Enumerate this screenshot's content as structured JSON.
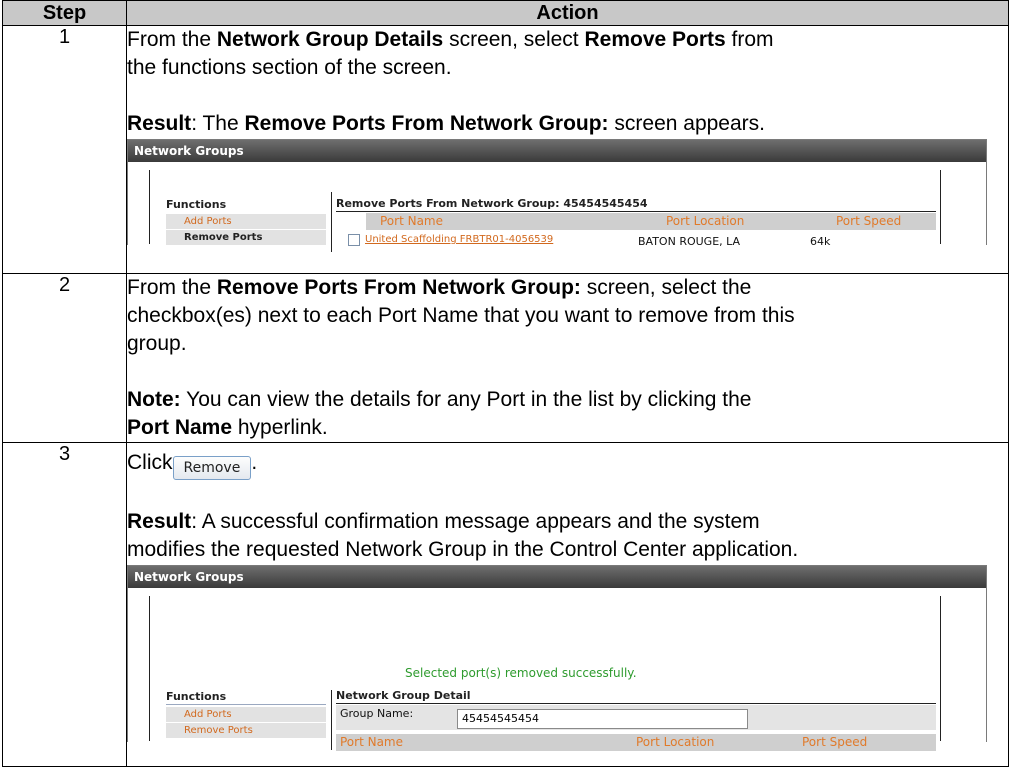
{
  "table": {
    "header_step": "Step",
    "header_action": "Action",
    "rows": [
      {
        "step": "1",
        "line1": {
          "t1": "From the ",
          "b1": "Network Group Details",
          "t2": " screen, select ",
          "b2": "Remove Ports",
          "t3": " from"
        },
        "line2": "the functions section of the screen.",
        "result": {
          "label": "Result",
          "t1": ":  The ",
          "b1": "Remove Ports From Network Group:",
          "t2": " screen appears."
        }
      },
      {
        "step": "2",
        "line1": {
          "t1": "From the ",
          "b1": "Remove Ports From Network Group:",
          "t2": " screen, select the"
        },
        "line2": "checkbox(es) next to each Port Name that you want to remove from this",
        "line3": "group.",
        "note": {
          "label": "Note:",
          "t1": "  You can view the details for any Port in the list by clicking the"
        },
        "note_line2": {
          "b1": "Port Name",
          "t1": " hyperlink."
        }
      },
      {
        "step": "3",
        "click": "Click",
        "button": "Remove",
        "period": ".",
        "result": {
          "label": "Result",
          "t1": ": A successful confirmation message appears and the system"
        },
        "result_line2": "modifies the requested Network Group in the Control Center application."
      }
    ]
  },
  "shot1": {
    "header": "Network Groups",
    "functions_title": "Functions",
    "functions": [
      "Add Ports",
      "Remove Ports"
    ],
    "section_title": "Remove Ports From Network Group: 45454545454",
    "columns": [
      "Port Name",
      "Port Location",
      "Port Speed"
    ],
    "row": {
      "name": "United Scaffolding FRBTR01-4056539",
      "location": "BATON ROUGE, LA",
      "speed": "64k"
    }
  },
  "shot2": {
    "header": "Network Groups",
    "success": "Selected port(s) removed successfully.",
    "functions_title": "Functions",
    "functions": [
      "Add Ports",
      "Remove Ports"
    ],
    "section_title": "Network Group Detail",
    "group_label": "Group Name:",
    "group_value": "45454545454",
    "columns": [
      "Port Name",
      "Port Location",
      "Port Speed"
    ]
  }
}
